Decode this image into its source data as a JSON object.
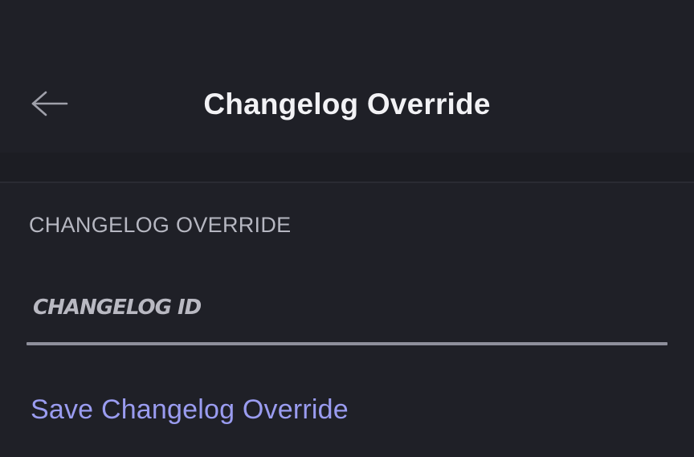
{
  "header": {
    "title": "Changelog Override",
    "back_icon": "arrow-left-icon"
  },
  "section": {
    "label": "CHANGELOG OVERRIDE"
  },
  "input": {
    "placeholder": "CHANGELOG ID",
    "value": ""
  },
  "actions": {
    "save_label": "Save Changelog Override"
  },
  "colors": {
    "background": "#1f2027",
    "title": "#f2f2f5",
    "label": "#b6b7c1",
    "underline": "#8e8f9b",
    "accent_link": "#9a9cf0"
  }
}
